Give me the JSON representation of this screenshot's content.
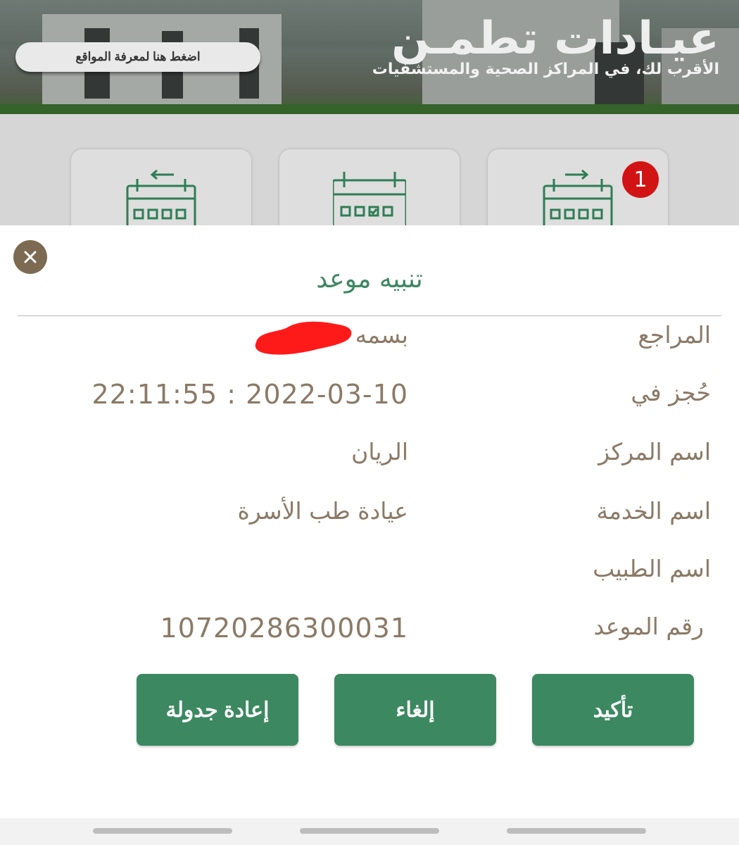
{
  "banner": {
    "title": "عيـادات تطمـن",
    "subtitle": "الأقرب لك، في المراكز الصحية والمستشفيات",
    "locations_button": "اضغط هنا لمعرفة المواقع"
  },
  "cards": {
    "badge_count": "1",
    "items": [
      {
        "icon": "calendar-arrow-right-icon"
      },
      {
        "icon": "calendar-check-icon"
      },
      {
        "icon": "calendar-arrow-left-icon"
      }
    ]
  },
  "modal": {
    "title": "تنبيه موعد",
    "close_icon": "close-icon",
    "rows": [
      {
        "label": "المراجع",
        "value": "بسمه"
      },
      {
        "label": "حُجز في",
        "value": "22:11:55 : 2022-03-10"
      },
      {
        "label": "اسم المركز",
        "value": "الريان"
      },
      {
        "label": "اسم الخدمة",
        "value": "عيادة طب الأسرة"
      },
      {
        "label": "اسم الطبيب",
        "value": ""
      },
      {
        "label": "رقم الموعد",
        "value": "10720286300031"
      }
    ],
    "buttons": {
      "confirm": "تأكيد",
      "cancel": "إلغاء",
      "reschedule": "إعادة جدولة"
    }
  },
  "colors": {
    "primary_green": "#3c8861",
    "title_green": "#3e8762",
    "text_brown": "#8b7a66",
    "badge_red": "#d11313",
    "close_brown": "#7d6a53"
  }
}
